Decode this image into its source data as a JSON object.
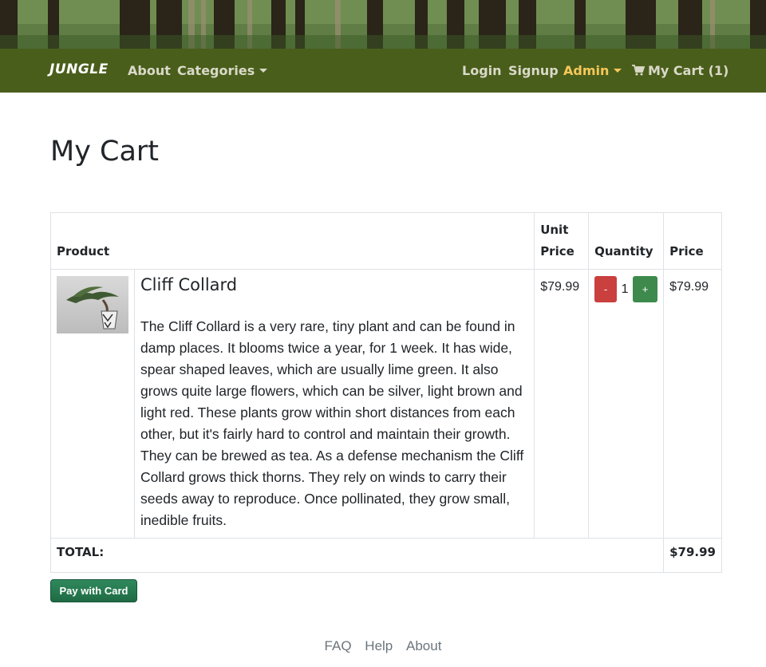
{
  "navbar": {
    "brand": "JUNGLE",
    "about": "About",
    "categories": "Categories",
    "login": "Login",
    "signup": "Signup",
    "admin": "Admin",
    "cart": "My Cart (1)"
  },
  "page": {
    "title": "My Cart"
  },
  "table": {
    "headers": {
      "product": "Product",
      "unit_price": "Unit Price",
      "quantity": "Quantity",
      "price": "Price"
    },
    "items": [
      {
        "name": "Cliff Collard",
        "description": "The Cliff Collard is a very rare, tiny plant and can be found in damp places. It blooms twice a year, for 1 week. It has wide, spear shaped leaves, which are usually lime green. It also grows quite large flowers, which can be silver, light brown and light red. These plants grow within short distances from each other, but it's fairly hard to control and maintain their growth. They can be brewed as tea. As a defense mechanism the Cliff Collard grows thick thorns. They rely on winds to carry their seeds away to reproduce. Once pollinated, they grow small, inedible fruits.",
        "unit_price": "$79.99",
        "quantity": "1",
        "price": "$79.99",
        "minus_label": "-",
        "plus_label": "+"
      }
    ],
    "total_label": "TOTAL:",
    "total_value": "$79.99"
  },
  "pay_button": "Pay with Card",
  "footer": {
    "faq": "FAQ",
    "help": "Help",
    "about": "About"
  },
  "colors": {
    "navbar": "#4a5e1b",
    "admin_active": "#f5c85a",
    "minus": "#c9403f",
    "plus": "#3e8a4c",
    "pay": "#2f8a5c"
  }
}
